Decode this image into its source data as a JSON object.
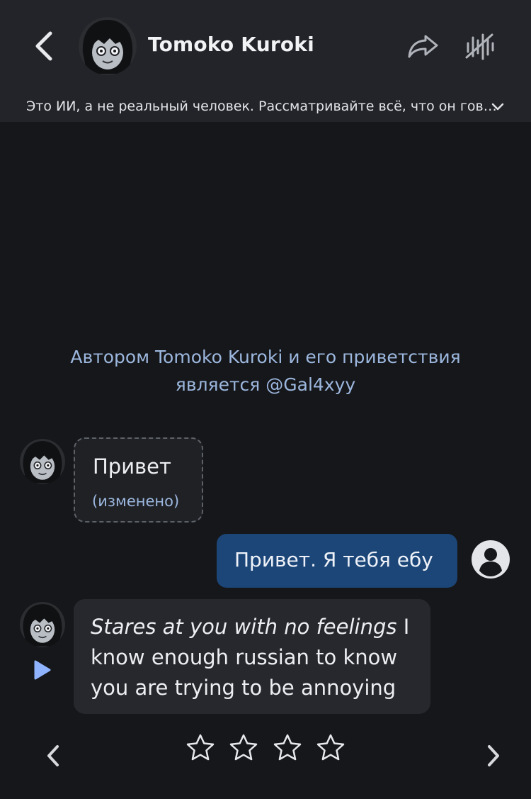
{
  "header": {
    "character_name": "Tomoko Kuroki",
    "back_icon": "chevron-left-icon",
    "share_icon": "share-icon",
    "voice_icon": "voice-off-icon"
  },
  "disclaimer": {
    "text": "Это ИИ, а не реальный человек. Рассматривайте всё, что он гов…",
    "icon": "chevron-down-icon"
  },
  "author_note": {
    "line1": "Автором Tomoko Kuroki и его приветствия",
    "line2": "является @Gal4xyy"
  },
  "messages": [
    {
      "sender": "character",
      "text": "Привет",
      "edited_label": "(изменено)"
    },
    {
      "sender": "user",
      "text": "Привет. Я тебя ебу"
    },
    {
      "sender": "character",
      "italic_text": "Stares at you with no feelings",
      "text": " I know enough russian to know you are trying to be annoying"
    }
  ],
  "rating": {
    "max": 5,
    "value": 0
  },
  "colors": {
    "background": "#16171a",
    "header": "#222429",
    "user_bubble": "#1c4678",
    "bot_bubble": "#26282d",
    "link": "#9cb7de",
    "play": "#8fb3ff"
  }
}
